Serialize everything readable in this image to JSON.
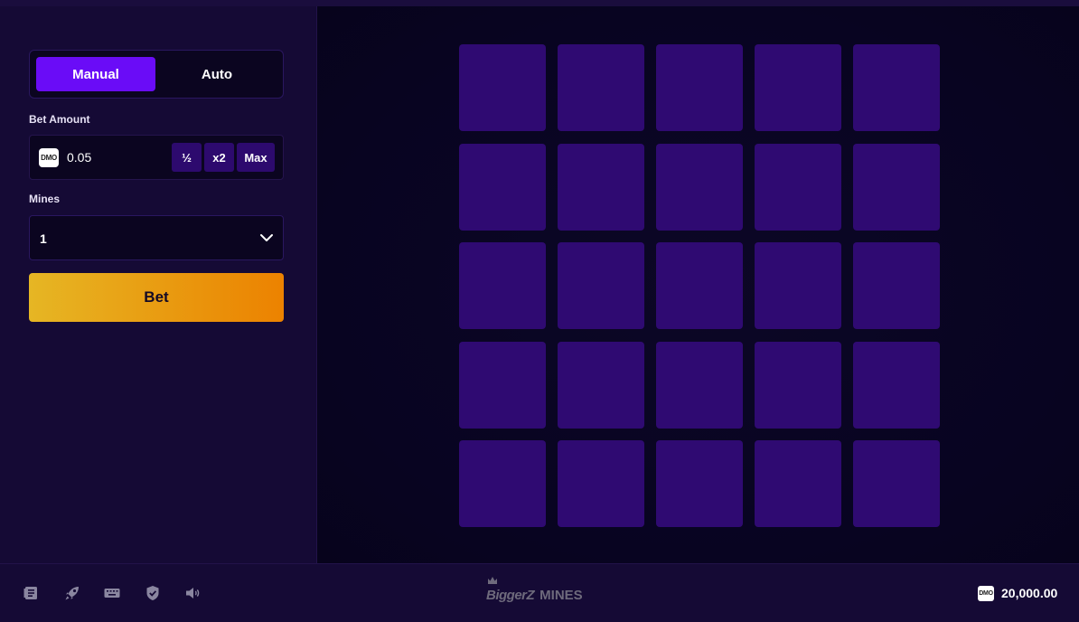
{
  "controls": {
    "modes": {
      "manual": "Manual",
      "auto": "Auto",
      "active": "Manual"
    },
    "bet_amount": {
      "label": "Bet Amount",
      "currency": "DMO",
      "value": "0.05",
      "half_label": "½",
      "double_label": "x2",
      "max_label": "Max"
    },
    "mines": {
      "label": "Mines",
      "selected": "1"
    },
    "bet_button": "Bet"
  },
  "board": {
    "rows": 5,
    "cols": 5,
    "tile_color": "#2f0a72"
  },
  "footer": {
    "icons": [
      "rules-book-icon",
      "rocket-icon",
      "keyboard-icon",
      "shield-check-icon",
      "sound-icon"
    ],
    "logo_brand": "BiggerZ",
    "logo_game": "MINES",
    "balance_currency": "DMO",
    "balance": "20,000.00"
  },
  "colors": {
    "accent": "#6a0cf7",
    "bet_gradient_start": "#e6b624",
    "bet_gradient_end": "#ec8200",
    "panel": "#150a35",
    "background": "#07041a"
  }
}
